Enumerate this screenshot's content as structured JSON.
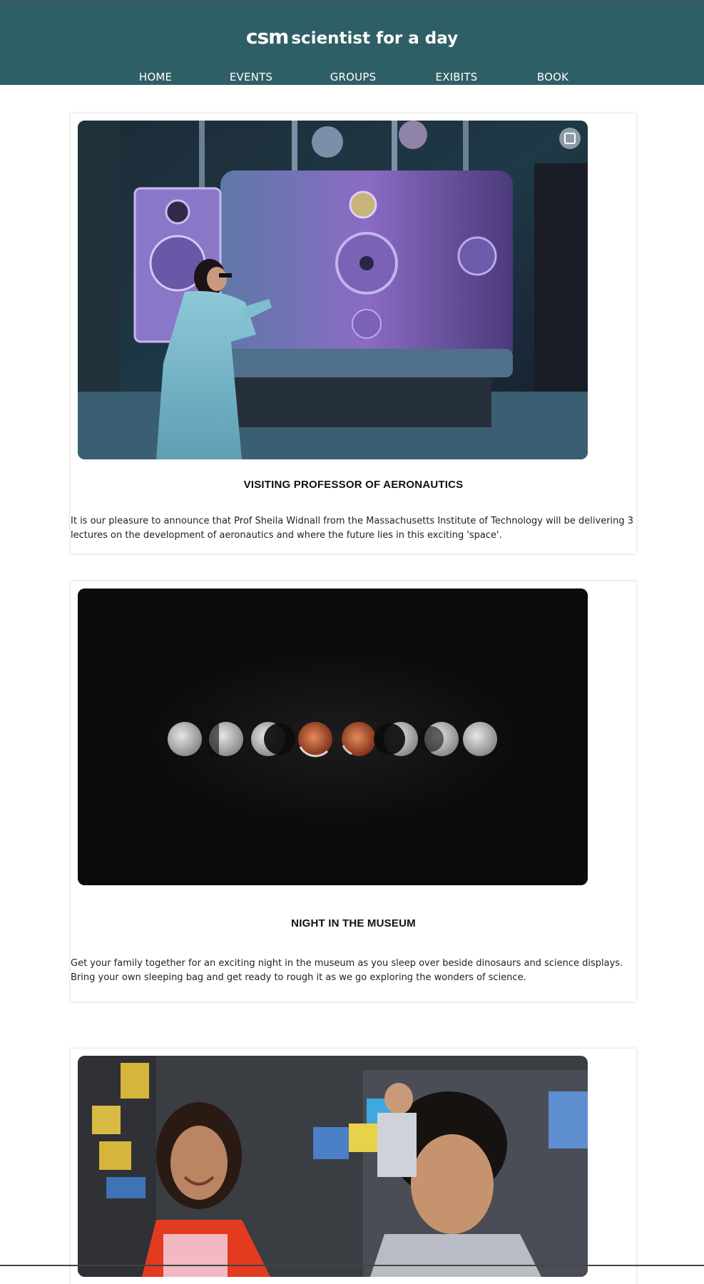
{
  "site": {
    "logo": "csm",
    "tagline": "scientist for a day",
    "nav": [
      "HOME",
      "EVENTS",
      "GROUPS",
      "EXIBITS",
      "BOOK"
    ]
  },
  "events": [
    {
      "title": "VISITING PROFESSOR OF AERONAUTICS",
      "description": "It is our pleasure to announce that Prof Sheila Widnall from the Massachusetts Institute of Technology will be delivering 3 lectures on the development of aeronautics and where the future lies in this exciting 'space'."
    },
    {
      "title": "NIGHT IN THE MUSEUM",
      "description": "Get your family together for an exciting night in the museum as you sleep over beside dinosaurs and science displays. Bring your own sleeping bag and get ready to rough it as we go exploring the wonders of science."
    },
    {
      "title": "",
      "description": ""
    }
  ]
}
